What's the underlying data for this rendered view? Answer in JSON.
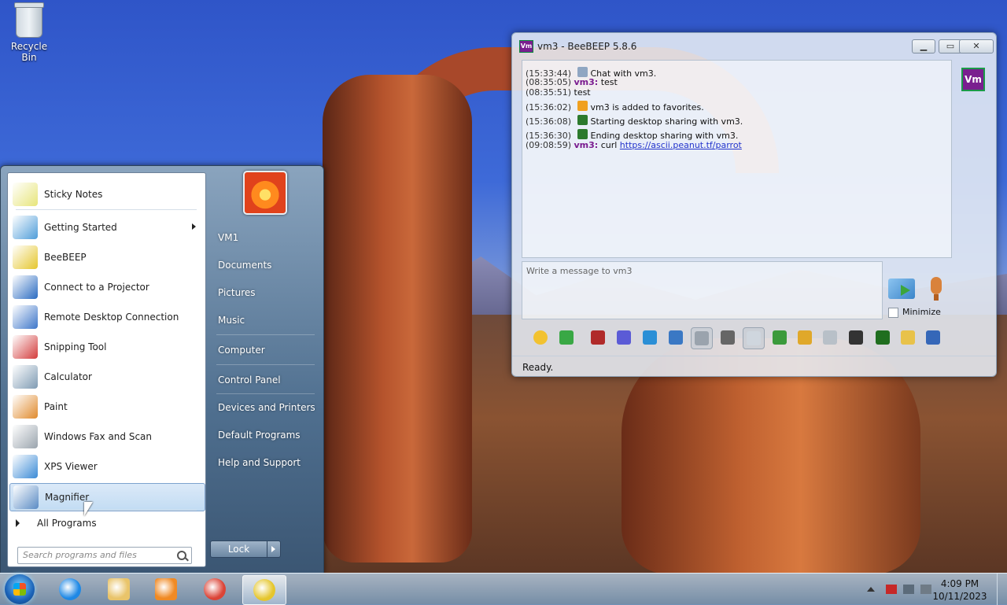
{
  "desktop": {
    "recycle_bin_label": "Recycle Bin"
  },
  "start_menu": {
    "programs": [
      {
        "label": "Sticky Notes",
        "icon": "sticky-notes-icon",
        "color": "#e7e57a",
        "submenu": false
      },
      {
        "label": "Getting Started",
        "icon": "getting-started-icon",
        "color": "#4f9dd9",
        "submenu": true
      },
      {
        "label": "BeeBEEP",
        "icon": "bee-icon",
        "color": "#e5c62d",
        "submenu": false
      },
      {
        "label": "Connect to a Projector",
        "icon": "projector-icon",
        "color": "#2a6bc1",
        "submenu": false
      },
      {
        "label": "Remote Desktop Connection",
        "icon": "remote-desktop-icon",
        "color": "#3d76c9",
        "submenu": false
      },
      {
        "label": "Snipping Tool",
        "icon": "scissors-icon",
        "color": "#d33c3c",
        "submenu": false
      },
      {
        "label": "Calculator",
        "icon": "calculator-icon",
        "color": "#7f9bb3",
        "submenu": false
      },
      {
        "label": "Paint",
        "icon": "paint-icon",
        "color": "#e08a2c",
        "submenu": false
      },
      {
        "label": "Windows Fax and Scan",
        "icon": "fax-icon",
        "color": "#9aa4ad",
        "submenu": false
      },
      {
        "label": "XPS Viewer",
        "icon": "xps-icon",
        "color": "#3a8ad6",
        "submenu": false
      },
      {
        "label": "Magnifier",
        "icon": "magnifier-icon",
        "color": "#5a8bc4",
        "submenu": false
      }
    ],
    "selected_program": "Magnifier",
    "all_programs_label": "All Programs",
    "search_placeholder": "Search programs and files",
    "right_links": [
      {
        "label": "VM1"
      },
      {
        "label": "Documents"
      },
      {
        "label": "Pictures"
      },
      {
        "label": "Music"
      },
      {
        "label": "Computer"
      },
      {
        "label": "Control Panel"
      },
      {
        "label": "Devices and Printers"
      },
      {
        "label": "Default Programs"
      },
      {
        "label": "Help and Support"
      }
    ],
    "lock_label": "Lock"
  },
  "taskbar": {
    "pinned": [
      {
        "icon": "internet-explorer-icon",
        "color": "#1e88e5"
      },
      {
        "icon": "folder-icon",
        "color": "#e9c46a"
      },
      {
        "icon": "media-player-icon",
        "color": "#f08a24"
      },
      {
        "icon": "chrome-icon",
        "color": "#db4437"
      },
      {
        "icon": "bee-icon",
        "color": "#e5c62d",
        "active": true
      }
    ],
    "clock_time": "4:09 PM",
    "clock_date": "10/11/2023"
  },
  "beebeep": {
    "title": "vm3 - BeeBEEP 5.8.6",
    "app_icon_text": "Vm",
    "avatar_text": "Vm",
    "chat_lines": [
      {
        "time": "(15:33:44)",
        "icon": "chat-bubble-icon",
        "icon_color": "#8fa6c2",
        "who": "",
        "text": "Chat with vm3."
      },
      {
        "time": "(08:35:05)",
        "icon": "",
        "who": "vm3:",
        "text": "test"
      },
      {
        "time": "(08:35:51)",
        "icon": "",
        "who": "",
        "text": "test"
      },
      {
        "time": "(15:36:02)",
        "icon": "star-icon",
        "icon_color": "#f0a020",
        "who": "",
        "text": "vm3 is added to favorites."
      },
      {
        "time": "(15:36:08)",
        "icon": "screen-share-icon",
        "icon_color": "#2d7a2d",
        "who": "",
        "text": "Starting desktop sharing with vm3."
      },
      {
        "time": "(15:36:30)",
        "icon": "screen-share-icon",
        "icon_color": "#2d7a2d",
        "who": "",
        "text": "Ending desktop sharing with vm3."
      },
      {
        "time": "(09:08:59)",
        "icon": "",
        "who": "vm3:",
        "text": "curl",
        "link": "https://ascii.peanut.tf/parrot"
      }
    ],
    "compose_placeholder": "Write a message to vm3",
    "minimize_label": "Minimize",
    "status": "Ready.",
    "tools": [
      {
        "icon": "emoji-icon",
        "color": "#f2c230"
      },
      {
        "icon": "download-icon",
        "color": "#39a845"
      },
      {
        "icon": "font-icon",
        "color": "#b02a2a"
      },
      {
        "icon": "color-picker-icon",
        "color": "#5b5bd6"
      },
      {
        "icon": "filter-icon",
        "color": "#2a8fd6"
      },
      {
        "icon": "settings-icon",
        "color": "#3a78c4"
      },
      {
        "icon": "tray-icon",
        "color": "#9aa3ad",
        "pressed": true
      },
      {
        "icon": "spellcheck-icon",
        "color": "#666666"
      },
      {
        "icon": "music-note-icon",
        "color": "#cfd6de",
        "pressed": true
      },
      {
        "icon": "send-file-icon",
        "color": "#3b9a3b"
      },
      {
        "icon": "send-folder-icon",
        "color": "#e0a82a"
      },
      {
        "icon": "code-icon",
        "color": "#b8c0c8"
      },
      {
        "icon": "webcam-icon",
        "color": "#333333"
      },
      {
        "icon": "screenshot-icon",
        "color": "#1f6e1f"
      },
      {
        "icon": "notes-icon",
        "color": "#e8c24a"
      },
      {
        "icon": "save-icon",
        "color": "#3567b8"
      }
    ]
  }
}
